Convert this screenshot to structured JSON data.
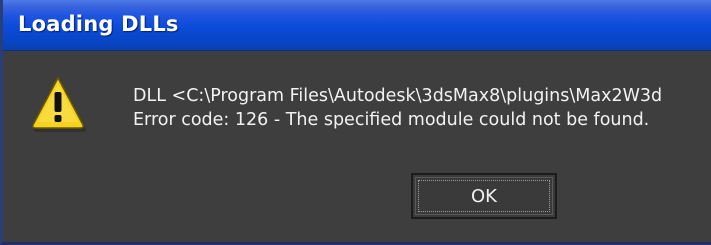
{
  "dialog": {
    "title": "Loading DLLs",
    "message_line1": "DLL <C:\\Program Files\\Autodesk\\3dsMax8\\plugins\\Max2W3d",
    "message_line2": "Error code: 126 - The specified module could not be found.",
    "ok_label": "OK",
    "icon": "warning-icon"
  },
  "colors": {
    "titlebar": "#0a4bd8",
    "background": "#3e3e3e",
    "warning_fill": "#f7d320"
  }
}
